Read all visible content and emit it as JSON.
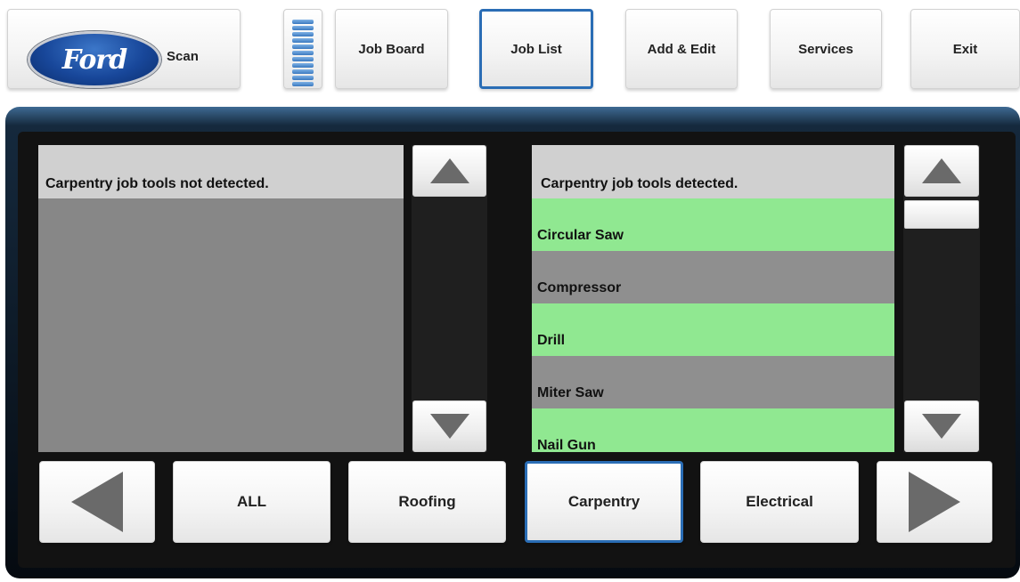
{
  "topbar": {
    "logo_text": "Ford",
    "scan_label": "Scan",
    "nav": [
      {
        "label": "Job Board",
        "active": false
      },
      {
        "label": "Job List",
        "active": true
      },
      {
        "label": "Add & Edit",
        "active": false
      },
      {
        "label": "Services",
        "active": false
      },
      {
        "label": "Exit",
        "active": false
      }
    ]
  },
  "left_panel": {
    "header": "Carpentry job tools not detected.",
    "items": []
  },
  "right_panel": {
    "header": "Carpentry job tools detected.",
    "items": [
      {
        "label": "Circular Saw",
        "status": "detected"
      },
      {
        "label": "Compressor",
        "status": "missing"
      },
      {
        "label": "Drill",
        "status": "detected"
      },
      {
        "label": "Miter Saw",
        "status": "missing"
      },
      {
        "label": "Nail Gun",
        "status": "detected"
      }
    ]
  },
  "categories": {
    "items": [
      {
        "label": "ALL",
        "active": false
      },
      {
        "label": "Roofing",
        "active": false
      },
      {
        "label": "Carpentry",
        "active": true
      },
      {
        "label": "Electrical",
        "active": false
      }
    ]
  },
  "icons": {
    "scroll_up": "triangle-up-icon",
    "scroll_down": "triangle-down-icon",
    "prev": "triangle-left-icon",
    "next": "triangle-right-icon"
  },
  "colors": {
    "detected": "#90e891",
    "missing": "#8f8f8f",
    "active_border": "#2a6db5",
    "header_bg": "#d0d0d0"
  }
}
